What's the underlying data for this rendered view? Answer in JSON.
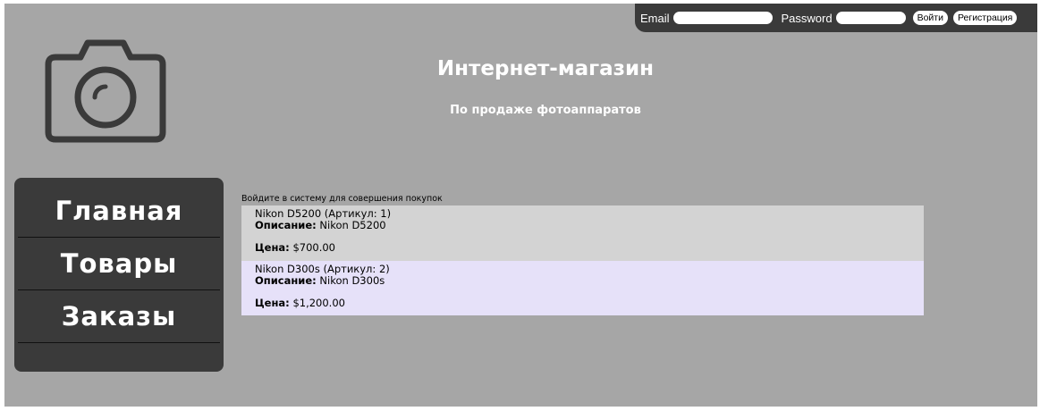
{
  "login": {
    "email_label": "Email",
    "email_value": "",
    "password_label": "Password",
    "password_value": "",
    "login_button": "Войти",
    "register_button": "Регистрация"
  },
  "header": {
    "title": "Интернет-магазин",
    "subtitle": "По продаже фотоаппаратов",
    "logo_icon": "camera-icon"
  },
  "sidebar": {
    "items": [
      {
        "label": "Главная"
      },
      {
        "label": "Товары"
      },
      {
        "label": "Заказы"
      }
    ]
  },
  "main": {
    "login_hint": "Войдите в систему для совершения покупок",
    "products": [
      {
        "name": "Nikon D5200 (Артикул: 1)",
        "description_label": "Описание:",
        "description": "Nikon D5200",
        "price_label": "Цена:",
        "price": "$700.00"
      },
      {
        "name": "Nikon D300s (Артикул: 2)",
        "description_label": "Описание:",
        "description": "Nikon D300s",
        "price_label": "Цена:",
        "price": "$1,200.00"
      }
    ]
  },
  "colors": {
    "page_background": "#a6a6a6",
    "dark_panel": "#3a3a3a",
    "product_row_1": "#d3d3d3",
    "product_row_2": "#e6e1f9"
  }
}
